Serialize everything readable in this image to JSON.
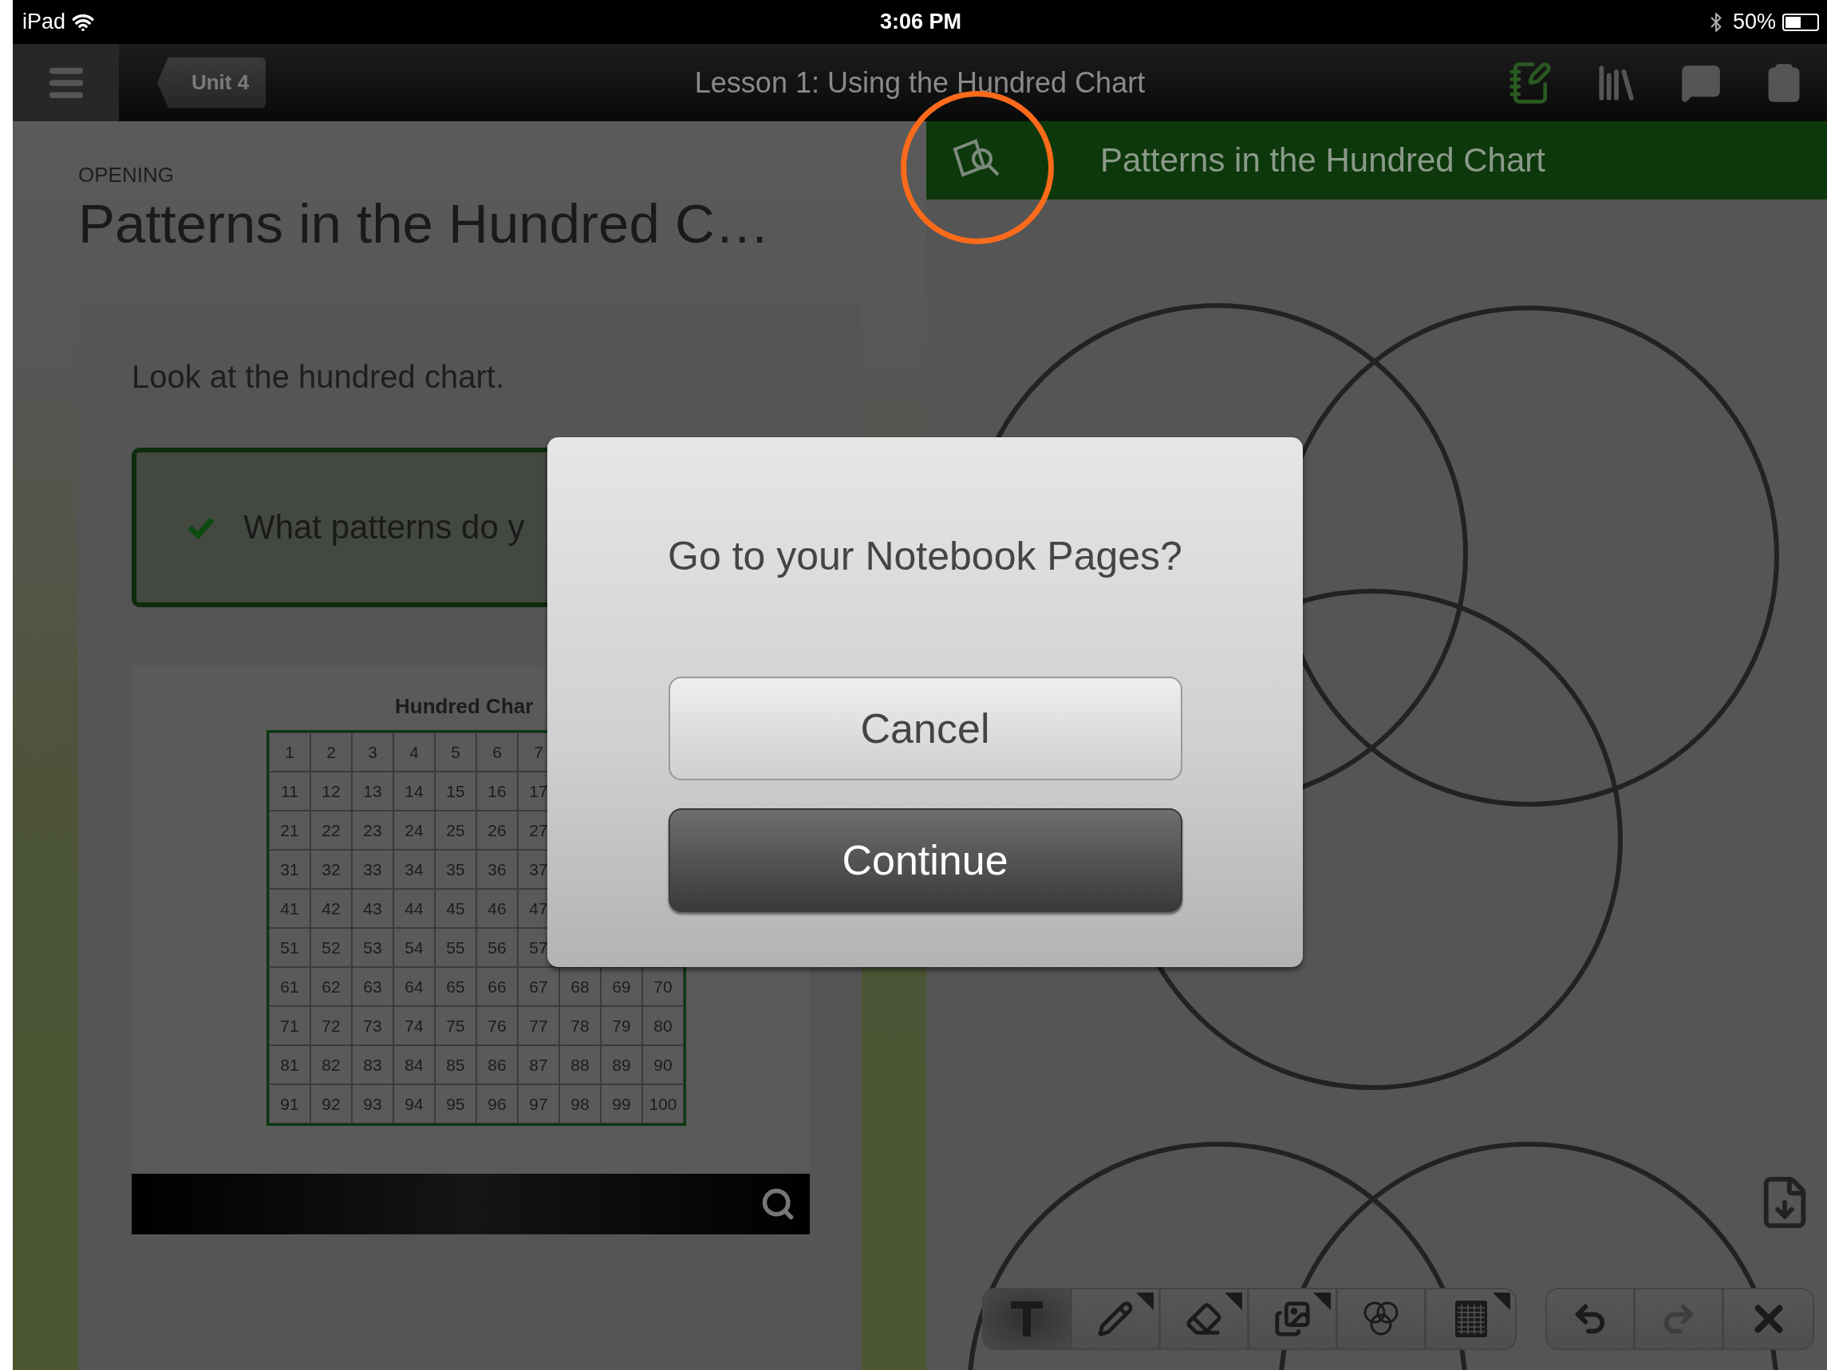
{
  "status_bar": {
    "device": "iPad",
    "time": "3:06 PM",
    "battery": "50%"
  },
  "nav_bar": {
    "back_button": "Unit 4",
    "title": "Lesson 1: Using the Hundred Chart"
  },
  "lesson": {
    "section": "OPENING",
    "title": "Patterns in the Hundred C…",
    "prompt": "Look at the hundred chart.",
    "question": {
      "text": "What patterns do y",
      "checked": true
    },
    "figure": {
      "title": "Hundred Char",
      "rows": [
        [
          "1",
          "2",
          "3",
          "4",
          "5",
          "6",
          "7"
        ],
        [
          "11",
          "12",
          "13",
          "14",
          "15",
          "16",
          "17"
        ],
        [
          "21",
          "22",
          "23",
          "24",
          "25",
          "26",
          "27"
        ],
        [
          "31",
          "32",
          "33",
          "34",
          "35",
          "36",
          "37"
        ],
        [
          "41",
          "42",
          "43",
          "44",
          "45",
          "46",
          "47"
        ],
        [
          "51",
          "52",
          "53",
          "54",
          "55",
          "56",
          "57"
        ],
        [
          "61",
          "62",
          "63",
          "64",
          "65",
          "66",
          "67",
          "68",
          "69",
          "70"
        ],
        [
          "71",
          "72",
          "73",
          "74",
          "75",
          "76",
          "77",
          "78",
          "79",
          "80"
        ],
        [
          "81",
          "82",
          "83",
          "84",
          "85",
          "86",
          "87",
          "88",
          "89",
          "90"
        ],
        [
          "91",
          "92",
          "93",
          "94",
          "95",
          "96",
          "97",
          "98",
          "99",
          "100"
        ]
      ]
    }
  },
  "notebook": {
    "header": "Patterns in the Hundred Chart",
    "tools": [
      {
        "kind": "text",
        "selected": true,
        "has_menu": false
      },
      {
        "kind": "pencil",
        "selected": false,
        "has_menu": true
      },
      {
        "kind": "eraser",
        "selected": false,
        "has_menu": true
      },
      {
        "kind": "images",
        "selected": false,
        "has_menu": true
      },
      {
        "kind": "circles",
        "selected": false,
        "has_menu": false
      },
      {
        "kind": "grid",
        "selected": false,
        "has_menu": true
      }
    ],
    "actions": [
      {
        "kind": "undo",
        "disabled": false
      },
      {
        "kind": "redo",
        "disabled": true
      },
      {
        "kind": "clear",
        "disabled": false
      }
    ]
  },
  "dialog": {
    "message": "Go to your Notebook Pages?",
    "buttons": [
      {
        "label": "Cancel",
        "kind": "secondary"
      },
      {
        "label": "Continue",
        "kind": "primary"
      }
    ]
  }
}
